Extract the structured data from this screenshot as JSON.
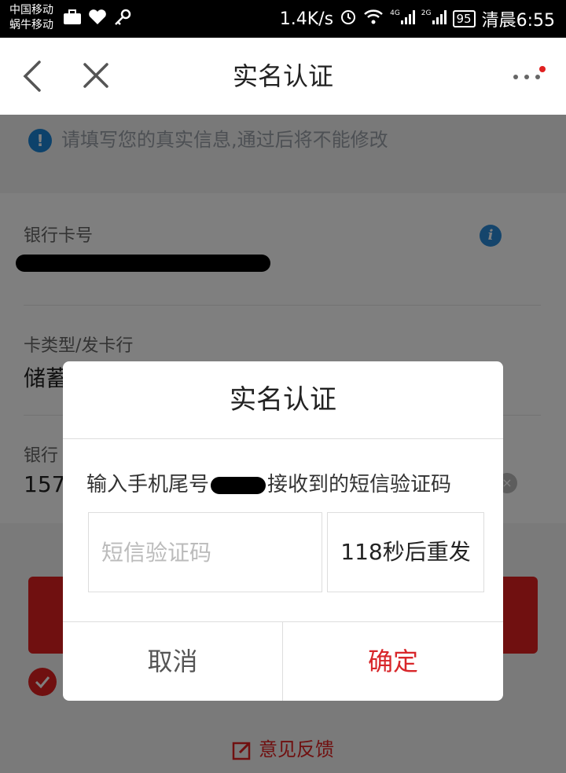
{
  "status_bar": {
    "carrier_1": "中国移动",
    "carrier_2": "蜗牛移动",
    "net_speed": "1.4K/s",
    "net_4g": "4G",
    "net_2g": "2G",
    "battery": "95",
    "time": "清晨6:55"
  },
  "navbar": {
    "title": "实名认证",
    "accent_color": "#e02020"
  },
  "notice": {
    "text": "请填写您的真实信息,通过后将不能修改"
  },
  "form": {
    "bank_card_label": "银行卡号",
    "card_type_label": "卡类型/发卡行",
    "card_type_value": "储蓄",
    "phone_label": "银行",
    "phone_value": "157"
  },
  "footer": {
    "feedback_label": "意见反馈"
  },
  "dialog": {
    "title": "实名认证",
    "message_prefix": "输入手机尾号",
    "message_suffix": "接收到的短信验证码",
    "sms_placeholder": "短信验证码",
    "sms_value": "",
    "resend_label": "118秒后重发",
    "cancel_label": "取消",
    "confirm_label": "确定"
  }
}
